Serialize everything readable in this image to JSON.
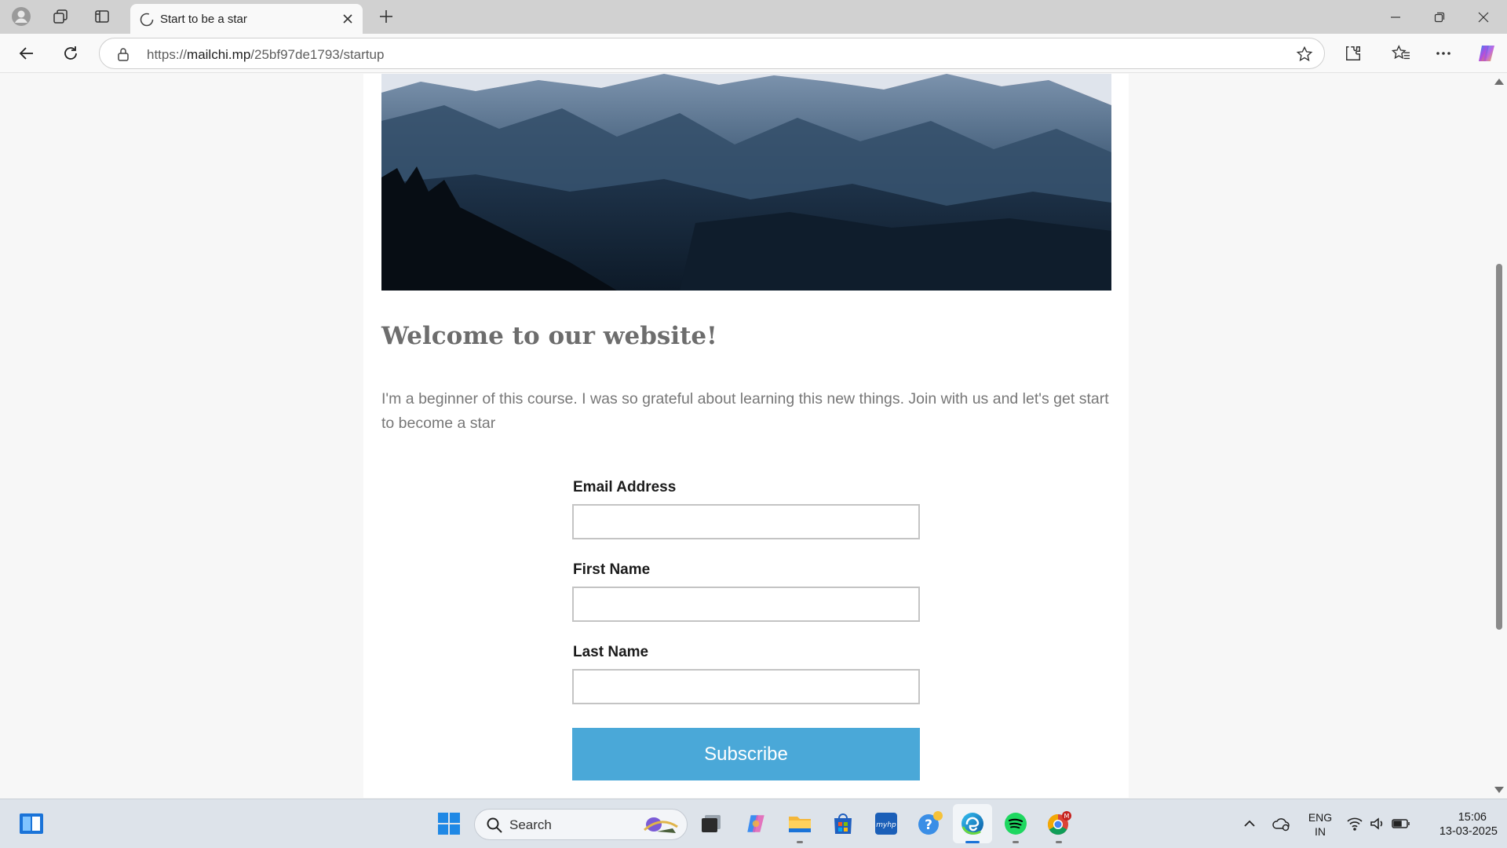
{
  "browser": {
    "tab_title": "Start to be a star",
    "url_scheme": "https://",
    "url_host": "mailchi.mp",
    "url_path": "/25bf97de1793/startup"
  },
  "page": {
    "heading": "Welcome to our website!",
    "intro": "I'm a beginner of this course. I was so grateful about learning this new things. Join with us and let's get start to become a star",
    "form": {
      "email_label": "Email Address",
      "first_name_label": "First Name",
      "last_name_label": "Last Name",
      "email_value": "",
      "first_name_value": "",
      "last_name_value": "",
      "submit_label": "Subscribe"
    },
    "colors": {
      "button": "#4aa8d8",
      "heading": "#6d6d6d",
      "body_text": "#777777"
    }
  },
  "taskbar": {
    "search_placeholder": "Search",
    "language_line1": "ENG",
    "language_line2": "IN",
    "time": "15:06",
    "date": "13-03-2025"
  }
}
